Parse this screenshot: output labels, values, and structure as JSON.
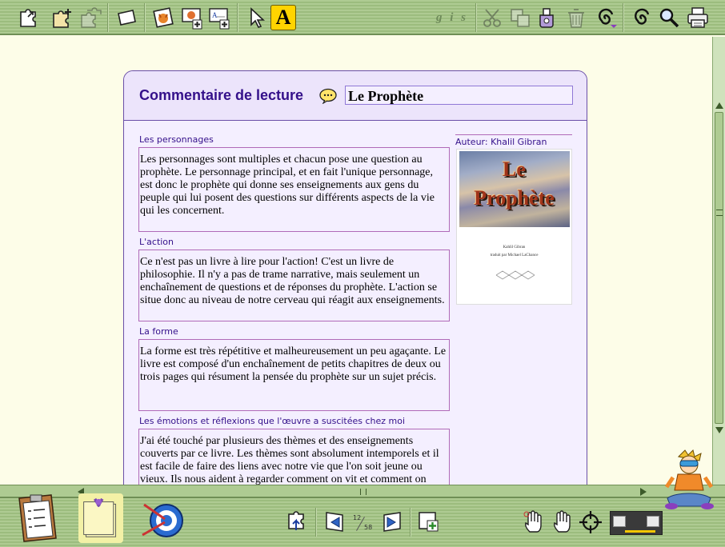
{
  "toolbar": {
    "format_letters": "g i s",
    "font_button_label": "A"
  },
  "document": {
    "card_title": "Commentaire de lecture",
    "book_title": "Le Prophète",
    "sections": [
      {
        "label": "Les personnages",
        "text": "Les personnages sont multiples et chacun pose une question au prophète. Le personnage principal, et en fait l'unique personnage, est donc le prophète qui donne ses enseignements aux gens du peuple qui lui posent des questions sur différents aspects de la vie qui les concernent."
      },
      {
        "label": "L'action",
        "text": "Ce n'est pas un livre à lire pour l'action! C'est un livre de philosophie. Il n'y a pas de trame narrative, mais seulement un enchaînement de questions et de réponses du prophète. L'action se situe donc au niveau de notre cerveau qui réagit aux enseignements."
      },
      {
        "label": "La forme",
        "text": "La forme est très répétitive et malheureusement un peu agaçante. Le livre est composé d'un enchaînement de petits chapitres de deux ou trois pages qui résument la pensée du prophète sur un sujet précis."
      },
      {
        "label": "Les émotions et réflexions que l'œuvre a suscitées chez moi",
        "text": "J'ai été touché par plusieurs des thèmes et des enseignements couverts par ce livre. Les thèmes sont absolument intemporels et il est facile de faire des liens avec notre vie que l'on soit jeune ou vieux. Ils nous aident à regarder comment on vit et comment on"
      }
    ],
    "author_label": "Auteur: Khalil Gibran",
    "cover": {
      "title_line1": "Le",
      "title_line2": "Prophète",
      "author": "Kahlil Gibran",
      "translator": "traduit par Michael LaChance"
    }
  },
  "pagination": {
    "current": "12",
    "total": "58"
  },
  "colors": {
    "toolbar_green": "#aecb92",
    "card_border": "#6a4ea8",
    "title_purple": "#34108a",
    "field_border": "#b06ab8",
    "highlight_yellow": "#ffd400"
  }
}
